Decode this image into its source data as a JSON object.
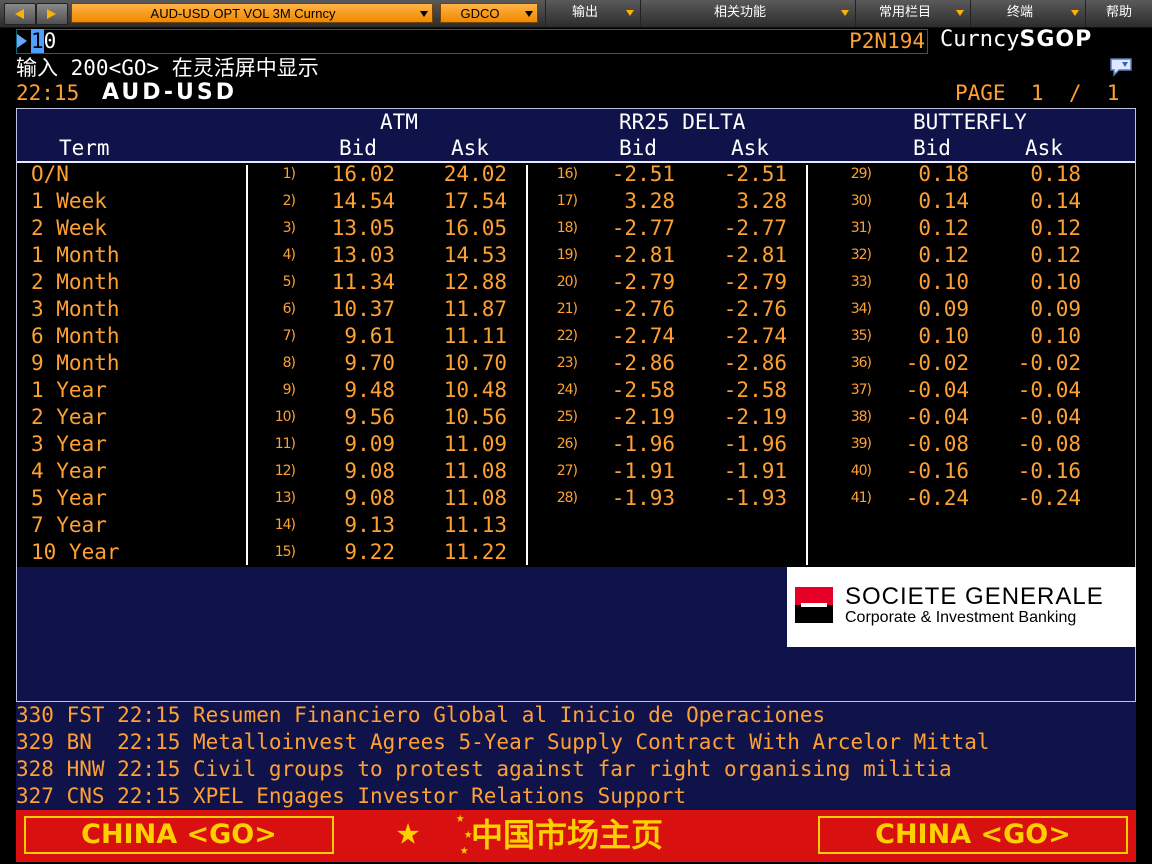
{
  "toolbar": {
    "security_field": "AUD-USD OPT VOL 3M Curncy",
    "source_field": "GDCO",
    "menus": [
      "输出",
      "相关功能",
      "常用栏目",
      "终端",
      "帮助"
    ]
  },
  "command_line": {
    "cursor_char": "1",
    "text": "0",
    "page_code": "P2N194",
    "security_type": "Curncy",
    "function": "SGOP"
  },
  "hint": "输入 200<GO> 在灵活屏中显示",
  "header": {
    "time": "22:15",
    "title": "AUD-USD",
    "page_label": "PAGE",
    "page_current": "1",
    "page_sep": "/",
    "page_total": "1"
  },
  "columns": {
    "group_atm": "ATM",
    "group_rr": "RR25 DELTA",
    "group_bf": "BUTTERFLY",
    "term": "Term",
    "bid": "Bid",
    "ask": "Ask"
  },
  "rows": [
    {
      "term": "O/N",
      "a_num": "1)",
      "a_bid": "16.02",
      "a_ask": "24.02",
      "r_num": "16)",
      "r_bid": "-2.51",
      "r_ask": "-2.51",
      "b_num": "29)",
      "b_bid": "0.18",
      "b_ask": "0.18"
    },
    {
      "term": "1 Week",
      "a_num": "2)",
      "a_bid": "14.54",
      "a_ask": "17.54",
      "r_num": "17)",
      "r_bid": "3.28",
      "r_ask": "3.28",
      "b_num": "30)",
      "b_bid": "0.14",
      "b_ask": "0.14"
    },
    {
      "term": "2 Week",
      "a_num": "3)",
      "a_bid": "13.05",
      "a_ask": "16.05",
      "r_num": "18)",
      "r_bid": "-2.77",
      "r_ask": "-2.77",
      "b_num": "31)",
      "b_bid": "0.12",
      "b_ask": "0.12"
    },
    {
      "term": "1 Month",
      "a_num": "4)",
      "a_bid": "13.03",
      "a_ask": "14.53",
      "r_num": "19)",
      "r_bid": "-2.81",
      "r_ask": "-2.81",
      "b_num": "32)",
      "b_bid": "0.12",
      "b_ask": "0.12"
    },
    {
      "term": "2 Month",
      "a_num": "5)",
      "a_bid": "11.34",
      "a_ask": "12.88",
      "r_num": "20)",
      "r_bid": "-2.79",
      "r_ask": "-2.79",
      "b_num": "33)",
      "b_bid": "0.10",
      "b_ask": "0.10"
    },
    {
      "term": "3 Month",
      "a_num": "6)",
      "a_bid": "10.37",
      "a_ask": "11.87",
      "r_num": "21)",
      "r_bid": "-2.76",
      "r_ask": "-2.76",
      "b_num": "34)",
      "b_bid": "0.09",
      "b_ask": "0.09"
    },
    {
      "term": "6 Month",
      "a_num": "7)",
      "a_bid": "9.61",
      "a_ask": "11.11",
      "r_num": "22)",
      "r_bid": "-2.74",
      "r_ask": "-2.74",
      "b_num": "35)",
      "b_bid": "0.10",
      "b_ask": "0.10"
    },
    {
      "term": "9 Month",
      "a_num": "8)",
      "a_bid": "9.70",
      "a_ask": "10.70",
      "r_num": "23)",
      "r_bid": "-2.86",
      "r_ask": "-2.86",
      "b_num": "36)",
      "b_bid": "-0.02",
      "b_ask": "-0.02"
    },
    {
      "term": "1 Year",
      "a_num": "9)",
      "a_bid": "9.48",
      "a_ask": "10.48",
      "r_num": "24)",
      "r_bid": "-2.58",
      "r_ask": "-2.58",
      "b_num": "37)",
      "b_bid": "-0.04",
      "b_ask": "-0.04"
    },
    {
      "term": "2 Year",
      "a_num": "10)",
      "a_bid": "9.56",
      "a_ask": "10.56",
      "r_num": "25)",
      "r_bid": "-2.19",
      "r_ask": "-2.19",
      "b_num": "38)",
      "b_bid": "-0.04",
      "b_ask": "-0.04"
    },
    {
      "term": "3 Year",
      "a_num": "11)",
      "a_bid": "9.09",
      "a_ask": "11.09",
      "r_num": "26)",
      "r_bid": "-1.96",
      "r_ask": "-1.96",
      "b_num": "39)",
      "b_bid": "-0.08",
      "b_ask": "-0.08"
    },
    {
      "term": "4 Year",
      "a_num": "12)",
      "a_bid": "9.08",
      "a_ask": "11.08",
      "r_num": "27)",
      "r_bid": "-1.91",
      "r_ask": "-1.91",
      "b_num": "40)",
      "b_bid": "-0.16",
      "b_ask": "-0.16"
    },
    {
      "term": "5 Year",
      "a_num": "13)",
      "a_bid": "9.08",
      "a_ask": "11.08",
      "r_num": "28)",
      "r_bid": "-1.93",
      "r_ask": "-1.93",
      "b_num": "41)",
      "b_bid": "-0.24",
      "b_ask": "-0.24"
    },
    {
      "term": "7 Year",
      "a_num": "14)",
      "a_bid": "9.13",
      "a_ask": "11.13",
      "r_num": "",
      "r_bid": "",
      "r_ask": "",
      "b_num": "",
      "b_bid": "",
      "b_ask": ""
    },
    {
      "term": "10 Year",
      "a_num": "15)",
      "a_bid": "9.22",
      "a_ask": "11.22",
      "r_num": "",
      "r_bid": "",
      "r_ask": "",
      "b_num": "",
      "b_bid": "",
      "b_ask": ""
    }
  ],
  "logo": {
    "name": "SOCIETE GENERALE",
    "subtitle": "Corporate & Investment Banking"
  },
  "news": [
    "330 FST 22:15 Resumen Financiero Global al Inicio de Operaciones",
    "329 BN  22:15 Metalloinvest Agrees 5-Year Supply Contract With Arcelor Mittal",
    "328 HNW 22:15 Civil groups to protest against far right organising militia",
    "327 CNS 22:15 XPEL Engages Investor Relations Support"
  ],
  "banner": {
    "left_button": "CHINA <GO>",
    "center_text": "中国市场主页",
    "right_button": "CHINA <GO>"
  },
  "icons": {
    "back": "arrow-left-icon",
    "forward": "arrow-right-icon",
    "dropdown": "caret-down-icon",
    "chat": "chat-bubble-icon",
    "star": "star-icon"
  },
  "colors": {
    "amber": "#ffa033",
    "panel_navy": "#10134a",
    "banner_red": "#d81010",
    "banner_yellow": "#ffd000"
  }
}
